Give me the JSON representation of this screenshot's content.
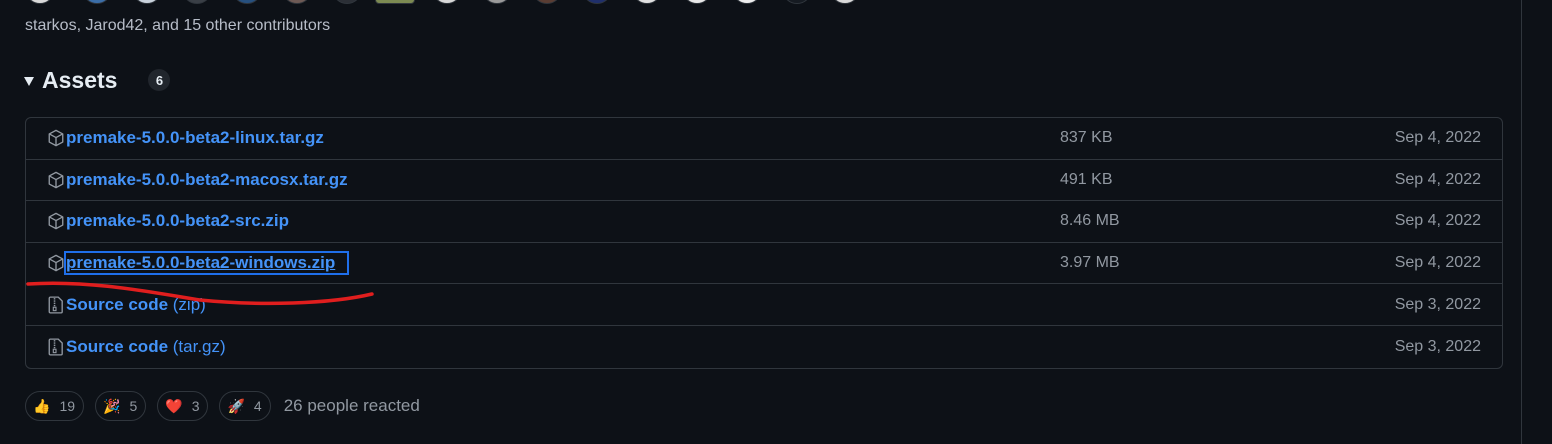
{
  "release": {
    "contributors_text": "starkos, Jarod42, and 15 other contributors",
    "avatar_colors": [
      "#d9d9d9",
      "#3b6ea8",
      "#c9d2dc",
      "#3a3f46",
      "#26507f",
      "#6e5a55",
      "#2b2f36",
      "#7c8a52",
      "#d8d8d8",
      "#9a9a9a",
      "#5a3d33",
      "#1f2f6b",
      "#e0e0e0",
      "#e8e8e8",
      "#ededed",
      "#161b22"
    ]
  },
  "assets": {
    "title": "Assets",
    "count": "6",
    "items": [
      {
        "name": "premake-5.0.0-beta2-linux.tar.gz",
        "suffix": "",
        "size": "837 KB",
        "date": "Sep 4, 2022",
        "icon": "package-icon"
      },
      {
        "name": "premake-5.0.0-beta2-macosx.tar.gz",
        "suffix": "",
        "size": "491 KB",
        "date": "Sep 4, 2022",
        "icon": "package-icon"
      },
      {
        "name": "premake-5.0.0-beta2-src.zip",
        "suffix": "",
        "size": "8.46 MB",
        "date": "Sep 4, 2022",
        "icon": "package-icon"
      },
      {
        "name": "premake-5.0.0-beta2-windows.zip",
        "suffix": "",
        "size": "3.97 MB",
        "date": "Sep 4, 2022",
        "icon": "package-icon"
      },
      {
        "name": "Source code",
        "suffix": " (zip)",
        "size": "",
        "date": "Sep 3, 2022",
        "icon": "file-zip-icon"
      },
      {
        "name": "Source code",
        "suffix": " (tar.gz)",
        "size": "",
        "date": "Sep 3, 2022",
        "icon": "file-zip-icon"
      }
    ]
  },
  "reactions": {
    "items": [
      {
        "emoji": "👍",
        "count": "19",
        "icon": "thumbs-up-icon"
      },
      {
        "emoji": "🎉",
        "count": "5",
        "icon": "party-popper-icon"
      },
      {
        "emoji": "❤️",
        "count": "3",
        "icon": "heart-icon"
      },
      {
        "emoji": "🚀",
        "count": "4",
        "icon": "rocket-icon"
      }
    ],
    "summary": "26 people reacted"
  },
  "colors": {
    "background": "#0d1117",
    "border": "#30363d",
    "link": "#4493f8",
    "muted": "#9198a1",
    "annotation_red": "#e01e1e",
    "focus_outline": "#1f6feb"
  }
}
